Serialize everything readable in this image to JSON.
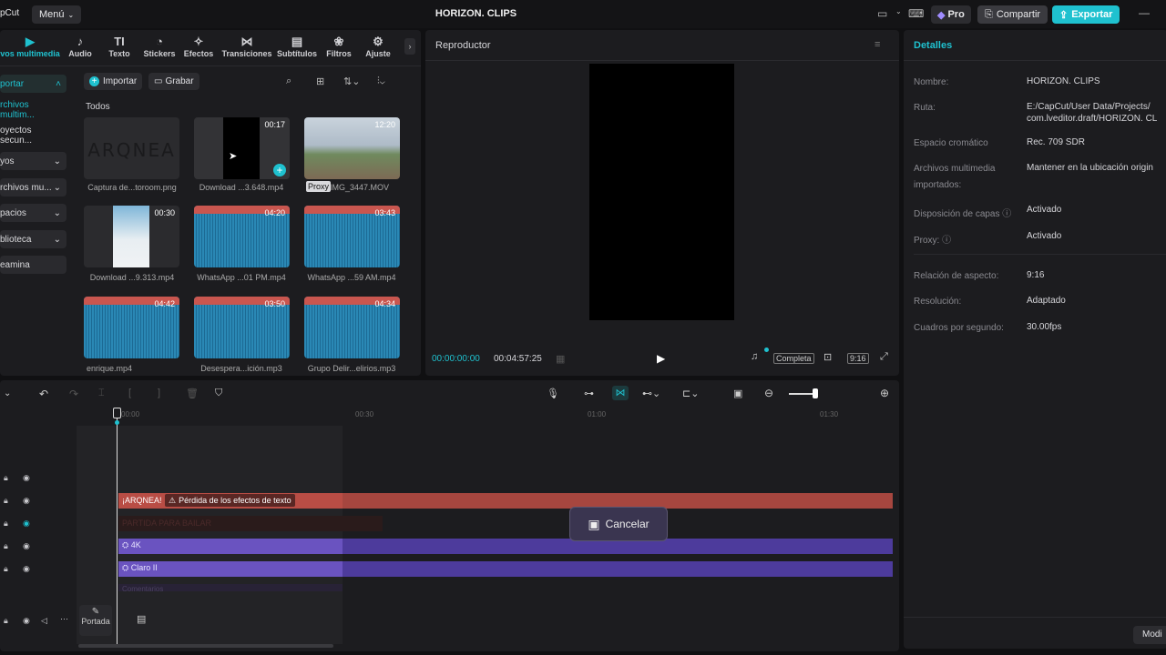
{
  "app": {
    "logo": "pCut",
    "menu": "Menú",
    "title": "HORIZON. CLIPS",
    "pro": "Pro",
    "share": "Compartir",
    "export": "Exportar"
  },
  "toolbar": {
    "tabs": [
      {
        "label": "vos multimedia",
        "icon": "▶"
      },
      {
        "label": "Audio",
        "icon": "♪"
      },
      {
        "label": "Texto",
        "icon": "TI"
      },
      {
        "label": "Stickers",
        "icon": "◔"
      },
      {
        "label": "Efectos",
        "icon": "✧"
      },
      {
        "label": "Transiciones",
        "icon": "⋈"
      },
      {
        "label": "Subtítulos",
        "icon": "▤"
      },
      {
        "label": "Filtros",
        "icon": "❀"
      },
      {
        "label": "Ajuste",
        "icon": "⚙"
      }
    ]
  },
  "sidebar": {
    "items": [
      "portar",
      "rchivos multim...",
      "oyectos secun...",
      "yos",
      "rchivos mu...",
      "pacios",
      "blioteca",
      "eamina"
    ]
  },
  "media": {
    "import": "Importar",
    "record": "Grabar",
    "section": "Todos",
    "proxy": "Proxy",
    "items": [
      {
        "caption": "Captura de...toroom.png",
        "duration": "",
        "logo": "ARQNEA"
      },
      {
        "caption": "Download ...3.648.mp4",
        "duration": "00:17"
      },
      {
        "caption": "IMG_3447.MOV",
        "duration": "12:20"
      },
      {
        "caption": "Download ...9.313.mp4",
        "duration": "00:30"
      },
      {
        "caption": "WhatsApp ...01 PM.mp4",
        "duration": "04:20"
      },
      {
        "caption": "WhatsApp ...59 AM.mp4",
        "duration": "03:43"
      },
      {
        "caption": "enrique.mp4",
        "duration": "04:42"
      },
      {
        "caption": "Desespera...ición.mp3",
        "duration": "03:50"
      },
      {
        "caption": "Grupo Delir...elirios.mp3",
        "duration": "04:34"
      }
    ]
  },
  "player": {
    "title": "Reproductor",
    "current": "00:00:00:00",
    "total": "00:04:57:25",
    "full": "Completa",
    "ratio": "9:16"
  },
  "details": {
    "title": "Detalles",
    "modify": "Modi",
    "rows": [
      {
        "label": "Nombre:",
        "value": "HORIZON. CLIPS"
      },
      {
        "label": "Ruta:",
        "value": "E:/CapCut/User Data/Projects/",
        "value2": "com.lveditor.draft/HORIZON. CL"
      },
      {
        "label": "Espacio cromático",
        "value": "Rec. 709 SDR"
      },
      {
        "label": "Archivos multimedia",
        "label2": "importados:",
        "value": "Mantener en la ubicación origin"
      },
      {
        "label": "Disposición de capas ⓘ",
        "value": "Activado"
      },
      {
        "label": "Proxy: ⓘ",
        "value": "Activado"
      },
      {
        "label": "Relación de aspecto:",
        "value": "9:16"
      },
      {
        "label": "Resolución:",
        "value": "Adaptado"
      },
      {
        "label": "Cuadros por segundo:",
        "value": "30.00fps"
      }
    ]
  },
  "timeline": {
    "ruler": [
      "00:00",
      "00:30",
      "01:00",
      "01:30"
    ],
    "tracks": [
      {
        "label": "¡ARQNEA!",
        "warning": "Pérdida de los efectos de texto"
      },
      {
        "label": "PARTIDA PARA BAILAR"
      },
      {
        "label": "4K"
      },
      {
        "label": "Claro II"
      },
      {
        "label": "Comentarios"
      }
    ],
    "cover": "Portada",
    "cancel": "Cancelar"
  },
  "colors": {
    "accent": "#1fc1cf",
    "text_track": "#a6463f",
    "effect_track": "#4d3b9c"
  }
}
